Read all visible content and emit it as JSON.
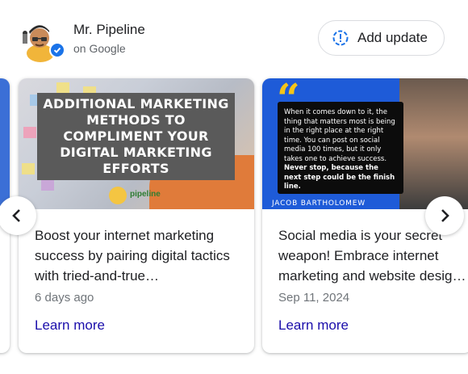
{
  "business": {
    "name": "Mr. Pipeline",
    "source": "on Google",
    "verified_icon": "check-badge-icon"
  },
  "actions": {
    "add_update_label": "Add update",
    "add_update_icon": "alert-circle-icon"
  },
  "posts": [
    {
      "image_text": "ADDITIONAL MARKETING\nMETHODS TO\nCOMPLIMENT YOUR\nDIGITAL MARKETING\nEFFORTS",
      "image_logo_text": "pipeline",
      "text_line1": "Boost your internet marketing",
      "text_line2": "success by pairing digital tactics",
      "text_line3": "with tried-and-true…",
      "date": "6 days ago",
      "link": "Learn more"
    },
    {
      "quote_plain": "When it comes down to it, the thing that matters most is being in the right place at the right time. You can post on social media 100 times, but it only takes one to achieve success. ",
      "quote_bold": "Never stop, because the next step could be the finish line.",
      "author": "JACOB BARTHOLOMEW",
      "text_line1": "Social media is your secret",
      "text_line2": "weapon! Embrace internet",
      "text_line3": "marketing and website desig…",
      "date": "Sep 11, 2024",
      "link": "Learn more"
    }
  ],
  "colors": {
    "accent": "#1a73e8",
    "link": "#1a0dab",
    "muted": "#70757a"
  }
}
